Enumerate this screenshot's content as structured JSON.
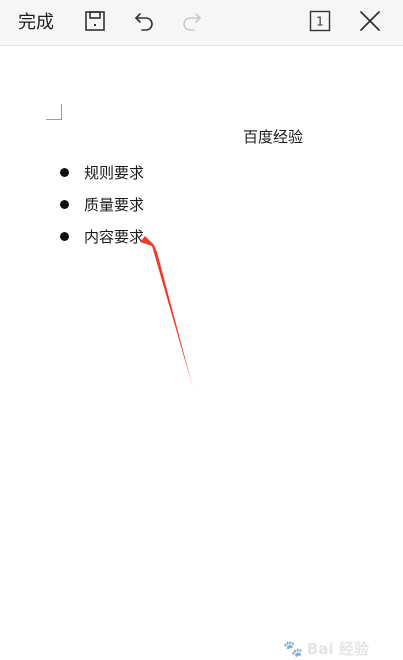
{
  "toolbar": {
    "done_label": "完成",
    "icons": [
      "save-icon",
      "undo-icon",
      "redo-icon",
      "page-count-icon",
      "close-icon"
    ],
    "page_count": "1"
  },
  "document": {
    "title": "百度经验",
    "bullets": [
      "规则要求",
      "质量要求",
      "内容要求"
    ]
  },
  "annotation": {
    "arrow_color": "#f03a2a"
  },
  "watermark": {
    "text": "Bai 经验"
  }
}
